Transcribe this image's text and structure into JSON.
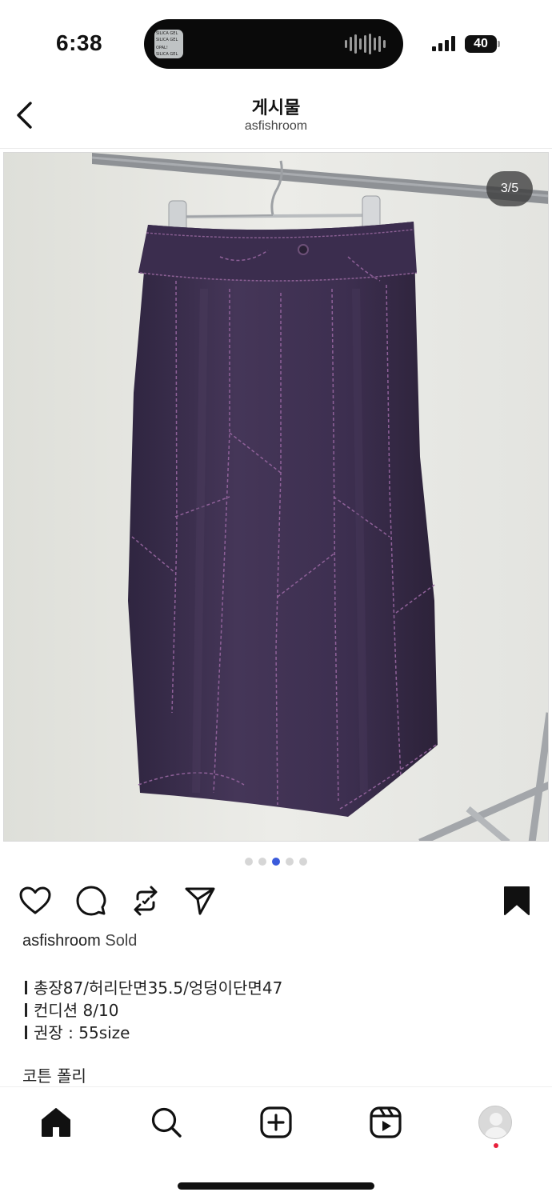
{
  "status_bar": {
    "time": "6:38",
    "battery": "40",
    "island_art_lines": [
      "SILICA GEL",
      "SILICA GEL",
      "OPAL!",
      "SILICA GEL"
    ]
  },
  "header": {
    "title": "게시물",
    "subtitle": "asfishroom",
    "back_icon": "chevron-left-icon"
  },
  "post": {
    "image_counter": "3/5",
    "image_subject": "purple denim maxi skirt on hanger",
    "carousel_total": 5,
    "carousel_active": 3,
    "actions": [
      "heart-icon",
      "comment-icon",
      "repost-icon",
      "share-icon",
      "bookmark-icon"
    ],
    "caption": {
      "username": "asfishroom",
      "text": "Sold",
      "lines": [
        "총장87/허리단면35.5/엉덩이단면47",
        "컨디션 8/10",
        "권장 : 55size"
      ],
      "extra": "코튼 폴리"
    }
  },
  "colors": {
    "accent_dot": "#3b5bdb",
    "skirt": "#3e2f52",
    "notification": "#e8203b"
  },
  "bottom_nav": {
    "items": [
      "home-icon",
      "search-icon",
      "create-icon",
      "reels-icon",
      "profile-avatar"
    ]
  }
}
